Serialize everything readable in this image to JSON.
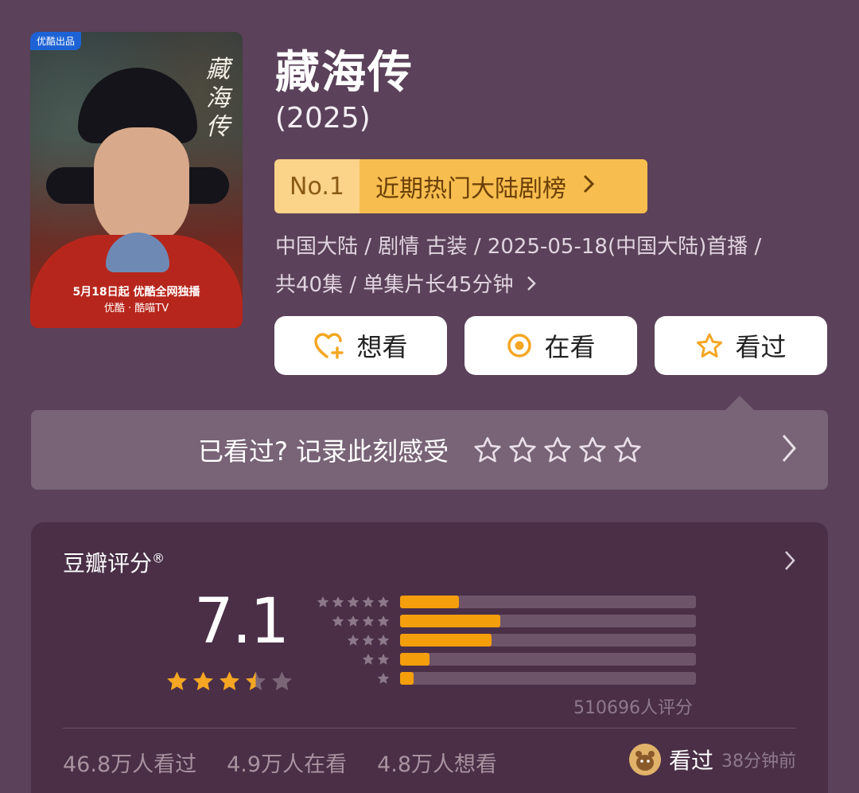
{
  "poster": {
    "badge": "优酷出品",
    "title_vertical": "藏海传",
    "date_line": "5月18日起 优酷全网独播",
    "platform_line": "优酷 · 酷喵TV"
  },
  "show": {
    "title": "藏海传",
    "year": "(2025)"
  },
  "rank": {
    "no": "No.1",
    "label": "近期热门大陆剧榜"
  },
  "meta": {
    "line1": "中国大陆 / 剧情 古装 / 2025-05-18(中国大陆)首播 /",
    "line2": "共40集 / 单集片长45分钟"
  },
  "actions": {
    "want": "想看",
    "watching": "在看",
    "watched": "看过"
  },
  "record": {
    "prompt": "已看过? 记录此刻感受"
  },
  "rating": {
    "title": "豆瓣评分",
    "reg_mark": "®",
    "score": "7.1",
    "stars_value": 3.5,
    "distribution": [
      {
        "stars": 5,
        "fraction": 0.2
      },
      {
        "stars": 4,
        "fraction": 0.34
      },
      {
        "stars": 3,
        "fraction": 0.31
      },
      {
        "stars": 2,
        "fraction": 0.1
      },
      {
        "stars": 1,
        "fraction": 0.045
      }
    ],
    "votes": "510696人评分"
  },
  "stats": {
    "watched": "46.8万人看过",
    "watching": "4.9万人在看",
    "want": "4.8万人想看"
  },
  "activity": {
    "label": "看过",
    "time": "38分钟前"
  },
  "colors": {
    "background": "#5b4159",
    "accent": "#f5a623",
    "bar_fill": "#f59e0b"
  }
}
